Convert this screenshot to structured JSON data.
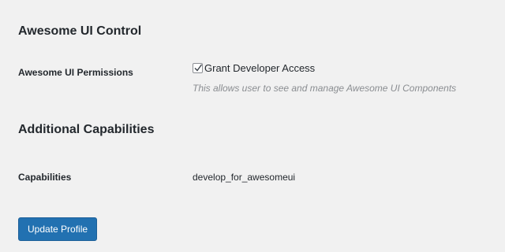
{
  "sections": {
    "control_title": "Awesome UI Control",
    "capabilities_title": "Additional Capabilities"
  },
  "permissions": {
    "label": "Awesome UI Permissions",
    "checkbox_label": "Grant Developer Access",
    "checked": true,
    "description": "This allows user to see and manage Awesome UI Components"
  },
  "capabilities": {
    "label": "Capabilities",
    "value": "develop_for_awesomeui"
  },
  "actions": {
    "update_label": "Update Profile"
  },
  "colors": {
    "background": "#f1f1f1",
    "button": "#2271b1",
    "muted_text": "#8a8d91"
  }
}
